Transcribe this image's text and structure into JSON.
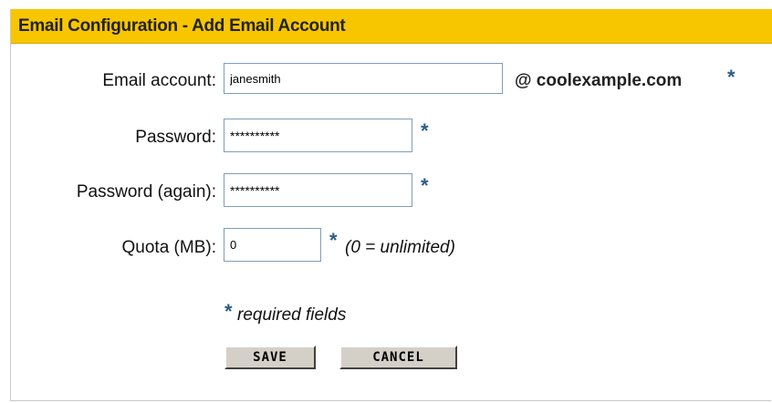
{
  "header": {
    "title": "Email Configuration - Add Email Account"
  },
  "form": {
    "email_account": {
      "label": "Email account:",
      "value": "janesmith",
      "domain": "@ coolexample.com"
    },
    "password": {
      "label": "Password:",
      "value": "**********"
    },
    "password_again": {
      "label": "Password (again):",
      "value": "**********"
    },
    "quota": {
      "label": "Quota (MB):",
      "value": "0",
      "hint": "(0 = unlimited)"
    },
    "required_marker": "*",
    "required_note": "required fields"
  },
  "buttons": {
    "save": "SAVE",
    "cancel": "CANCEL"
  },
  "colors": {
    "header_bg": "#f7c600",
    "asterisk": "#2d5d86",
    "button_face": "#d4d0c8"
  }
}
